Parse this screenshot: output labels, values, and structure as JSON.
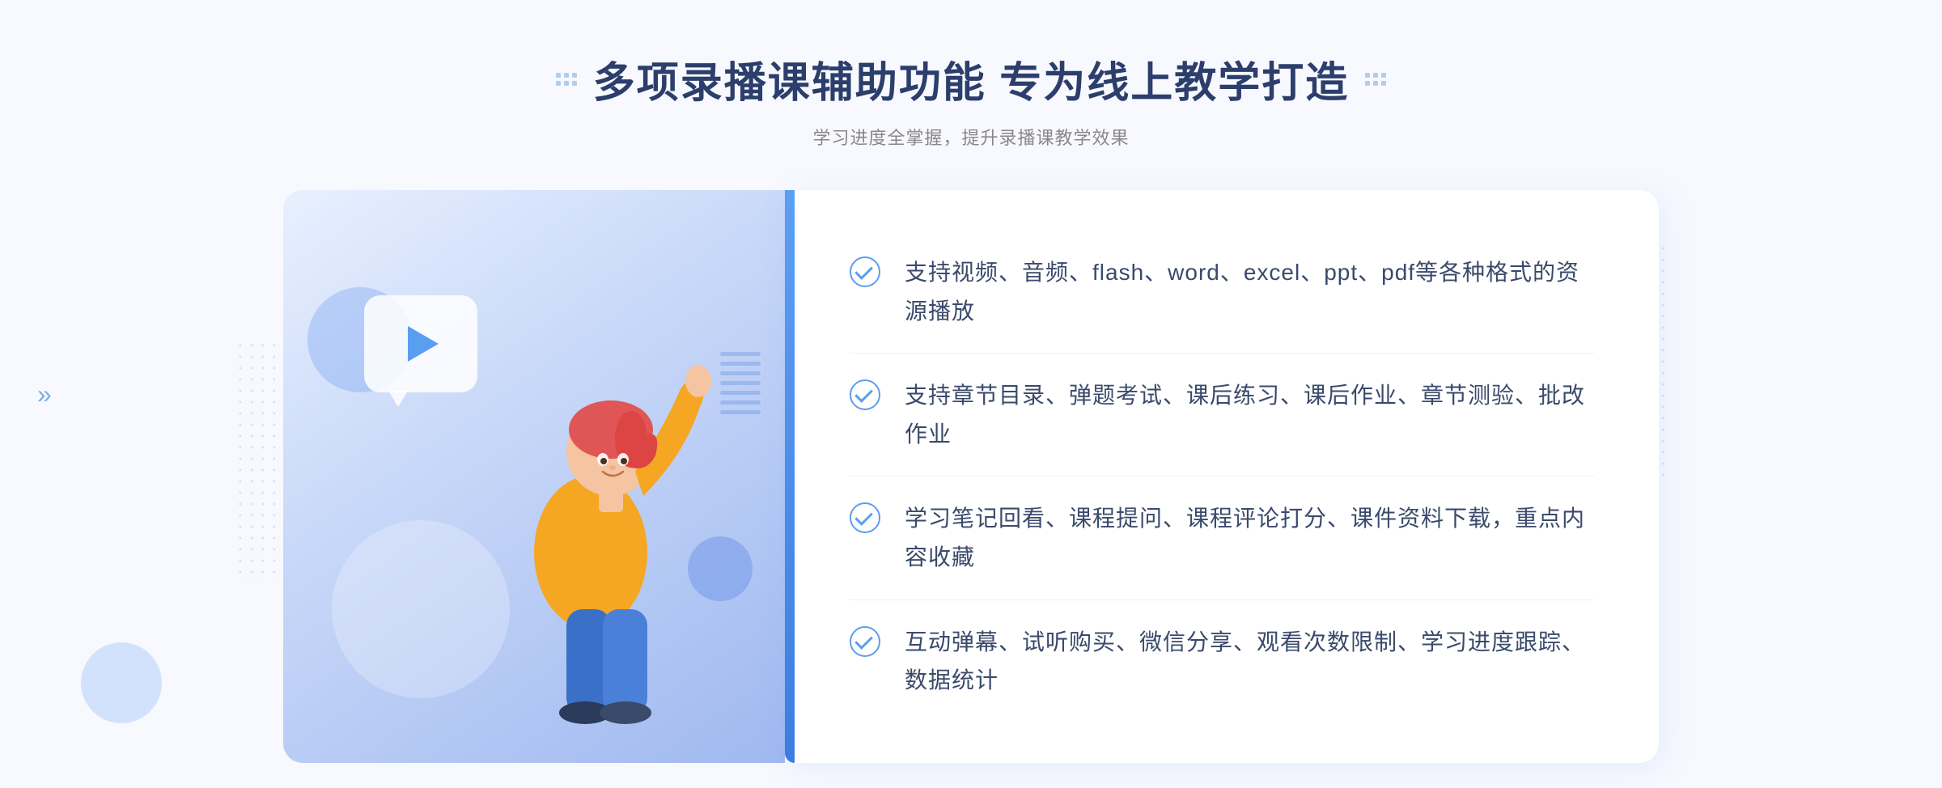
{
  "header": {
    "title": "多项录播课辅助功能 专为线上教学打造",
    "subtitle": "学习进度全掌握，提升录播课教学效果"
  },
  "features": [
    {
      "id": "feature-1",
      "text": "支持视频、音频、flash、word、excel、ppt、pdf等各种格式的资源播放"
    },
    {
      "id": "feature-2",
      "text": "支持章节目录、弹题考试、课后练习、课后作业、章节测验、批改作业"
    },
    {
      "id": "feature-3",
      "text": "学习笔记回看、课程提问、课程评论打分、课件资料下载，重点内容收藏"
    },
    {
      "id": "feature-4",
      "text": "互动弹幕、试听购买、微信分享、观看次数限制、学习进度跟踪、数据统计"
    }
  ],
  "decorators": {
    "left_arrow": "»",
    "check_label": "check-icon"
  }
}
